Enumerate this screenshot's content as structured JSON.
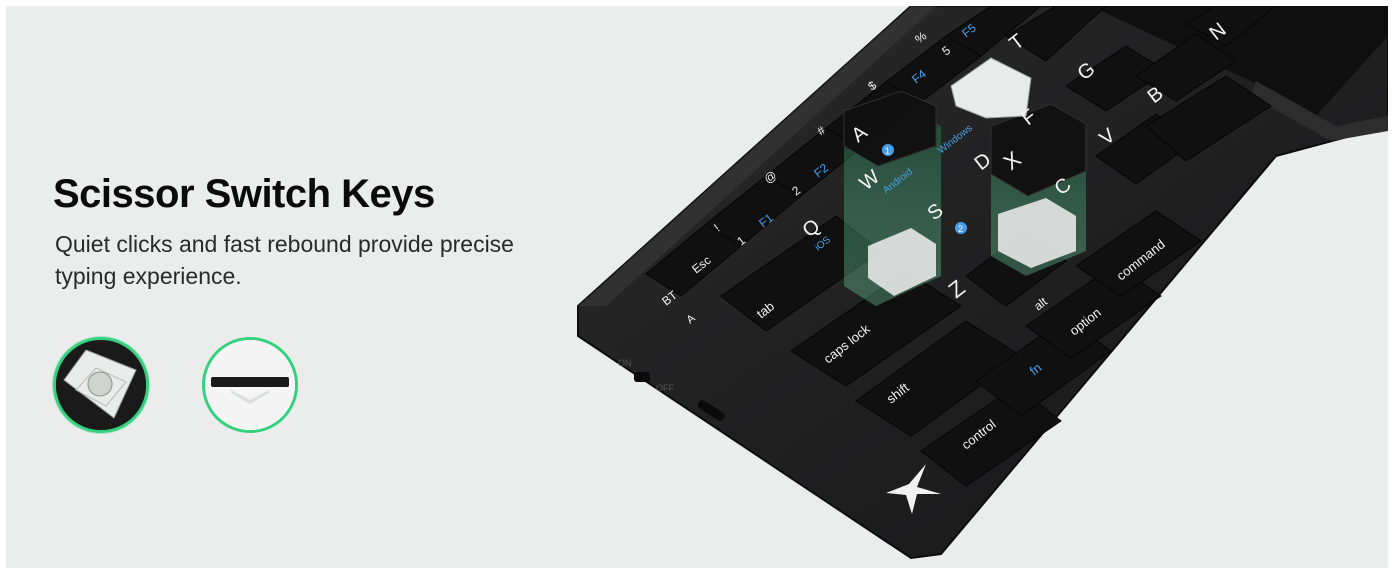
{
  "banner": {
    "title": "Scissor Switch Keys",
    "subtitle": "Quiet clicks and fast rebound provide precise typing experience.",
    "accent_color": "#34d17f",
    "background_color": "#ebecec"
  },
  "thumbnails": [
    {
      "icon": "scissor-switch-top-view-icon",
      "active": true
    },
    {
      "icon": "scissor-switch-side-view-icon",
      "active": false
    }
  ],
  "keyboard": {
    "keys": {
      "esc": "Esc",
      "tab": "tab",
      "caps": "caps lock",
      "shift": "shift",
      "control": "control",
      "fn": "fn",
      "alt": "alt",
      "option": "option",
      "command": "command",
      "q": "Q",
      "a": "A",
      "w": "W",
      "s": "S",
      "z": "Z",
      "x": "X",
      "c": "C",
      "d": "D",
      "v": "V",
      "b": "B",
      "g": "G",
      "t": "T",
      "n": "N",
      "f": "F",
      "n1": "1",
      "n2": "2",
      "n5": "5",
      "f1": "F1",
      "f2": "F2",
      "f4": "F4",
      "f5": "F5",
      "excl": "!",
      "at": "@",
      "hash": "#",
      "dollar": "$",
      "pct": "%"
    },
    "os_labels": {
      "ios": "iOS",
      "android": "Android",
      "windows": "Windows"
    },
    "badges": {
      "one": "1",
      "two": "2"
    },
    "side_labels": {
      "bt": "BT",
      "a": "A",
      "on": "ON",
      "off": "OFF"
    }
  }
}
